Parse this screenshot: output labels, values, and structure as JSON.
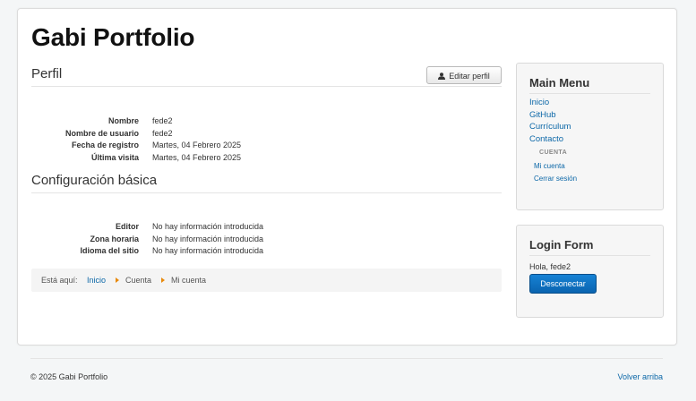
{
  "site": {
    "title": "Gabi Portfolio"
  },
  "profile": {
    "heading": "Perfil",
    "edit_label": "Editar perfil",
    "fields": [
      {
        "label": "Nombre",
        "value": "fede2"
      },
      {
        "label": "Nombre de usuario",
        "value": "fede2"
      },
      {
        "label": "Fecha de registro",
        "value": "Martes, 04 Febrero 2025"
      },
      {
        "label": "Última visita",
        "value": "Martes, 04 Febrero 2025"
      }
    ]
  },
  "config": {
    "heading": "Configuración básica",
    "fields": [
      {
        "label": "Editor",
        "value": "No hay información introducida"
      },
      {
        "label": "Zona horaria",
        "value": "No hay información introducida"
      },
      {
        "label": "Idioma del sitio",
        "value": "No hay información introducida"
      }
    ]
  },
  "breadcrumb": {
    "prefix": "Está aquí:",
    "items": [
      "Inicio",
      "Cuenta",
      "Mi cuenta"
    ]
  },
  "main_menu": {
    "title": "Main Menu",
    "items": [
      "Inicio",
      "GitHub",
      "Currículum",
      "Contacto"
    ],
    "category": "CUENTA",
    "sub_items": [
      "Mi cuenta",
      "Cerrar sesión"
    ]
  },
  "login": {
    "title": "Login Form",
    "greeting": "Hola, fede2",
    "button": "Desconectar"
  },
  "footer": {
    "copyright": "© 2025 Gabi Portfolio",
    "back_to_top": "Volver arriba"
  },
  "colors": {
    "link": "#0d68a8",
    "primary_button": "#0a64b0",
    "breadcrumb_arrow": "#e8890c"
  }
}
